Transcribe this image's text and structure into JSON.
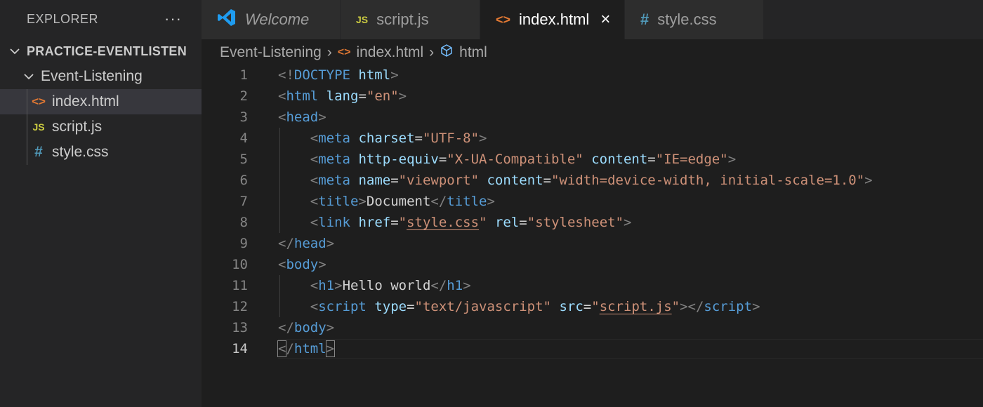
{
  "sidebar": {
    "title": "EXPLORER",
    "more_icon": "···",
    "project": "PRACTICE-EVENTLISTEN",
    "folder": "Event-Listening",
    "files": [
      {
        "name": "index.html",
        "icon": "html-icon",
        "glyph": "<>"
      },
      {
        "name": "script.js",
        "icon": "js-icon",
        "glyph": "JS"
      },
      {
        "name": "style.css",
        "icon": "css-icon",
        "glyph": "#"
      }
    ]
  },
  "tabs": [
    {
      "label": "Welcome",
      "icon": "vscode-icon"
    },
    {
      "label": "script.js",
      "icon": "js-icon",
      "glyph": "JS"
    },
    {
      "label": "index.html",
      "icon": "html-icon",
      "glyph": "<>",
      "active": true,
      "close": "×"
    },
    {
      "label": "style.css",
      "icon": "css-icon",
      "glyph": "#"
    }
  ],
  "breadcrumb": {
    "folder": "Event-Listening",
    "file": "index.html",
    "symbol": "html",
    "separator": "›"
  },
  "editor": {
    "current_line": 14,
    "lines": [
      {
        "n": "1"
      },
      {
        "n": "2"
      },
      {
        "n": "3"
      },
      {
        "n": "4"
      },
      {
        "n": "5"
      },
      {
        "n": "6"
      },
      {
        "n": "7"
      },
      {
        "n": "8"
      },
      {
        "n": "9"
      },
      {
        "n": "10"
      },
      {
        "n": "11"
      },
      {
        "n": "12"
      },
      {
        "n": "13"
      },
      {
        "n": "14"
      }
    ],
    "tokens": {
      "l1": [
        "<!",
        "DOCTYPE",
        " ",
        "html",
        ">"
      ],
      "l2": [
        "<",
        "html",
        " ",
        "lang",
        "=",
        "\"en\"",
        ">"
      ],
      "l3": [
        "<",
        "head",
        ">"
      ],
      "l4": [
        "<",
        "meta",
        " ",
        "charset",
        "=",
        "\"UTF-8\"",
        ">"
      ],
      "l5": [
        "<",
        "meta",
        " ",
        "http-equiv",
        "=",
        "\"X-UA-Compatible\"",
        " ",
        "content",
        "=",
        "\"IE=edge\"",
        ">"
      ],
      "l6": [
        "<",
        "meta",
        " ",
        "name",
        "=",
        "\"viewport\"",
        " ",
        "content",
        "=",
        "\"width=device-width, initial-scale=1.0\"",
        ">"
      ],
      "l7": [
        "<",
        "title",
        ">",
        "Document",
        "</",
        "title",
        ">"
      ],
      "l8": [
        "<",
        "link",
        " ",
        "href",
        "=",
        "\"",
        "style.css",
        "\"",
        " ",
        "rel",
        "=",
        "\"stylesheet\"",
        ">"
      ],
      "l9": [
        "</",
        "head",
        ">"
      ],
      "l10": [
        "<",
        "body",
        ">"
      ],
      "l11": [
        "<",
        "h1",
        ">",
        "Hello world",
        "</",
        "h1",
        ">"
      ],
      "l12": [
        "<",
        "script",
        " ",
        "type",
        "=",
        "\"text/javascript\"",
        " ",
        "src",
        "=",
        "\"",
        "script.js",
        "\"",
        "></",
        "script",
        ">"
      ],
      "l13": [
        "</",
        "body",
        ">"
      ],
      "l14": [
        "<",
        "/",
        "html",
        ">"
      ]
    }
  },
  "colors": {
    "tag": "#569cd6",
    "attribute": "#9cdcfe",
    "string": "#ce9178",
    "text": "#d4d4d4",
    "punctuation": "#808080",
    "html_icon": "#e37933",
    "js_icon": "#cbcb41",
    "css_icon": "#519aba",
    "vscode_logo": "#1f9cf0"
  }
}
